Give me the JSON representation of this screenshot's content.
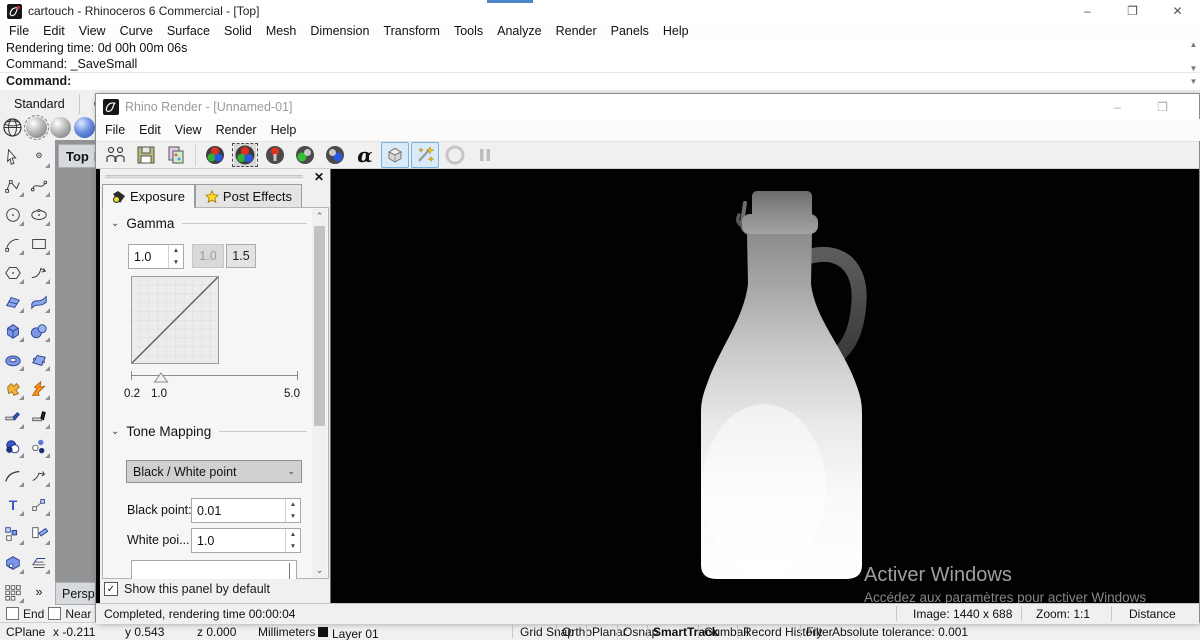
{
  "colors": {
    "accent_blue": "#4a86c8",
    "selection_bg": "#d9eaf8",
    "selection_border": "#7ab0de",
    "viewport_gray": "#919395",
    "watermark": "#9f9f9f",
    "render_bg": "#020202"
  },
  "icons": {
    "close": "✕",
    "minimize": "–",
    "restore": "❐",
    "chevron_down": "⌄",
    "dropdown": "˅",
    "scroll_up": "▲",
    "scroll_down": "▼",
    "spin_up": "▲",
    "spin_down": "▼",
    "check": "✓",
    "expand": "»",
    "viewport_dropdown": "▼",
    "alpha": "α"
  },
  "app": {
    "title": "cartouch - Rhinoceros 6 Commercial - [Top]",
    "menus": [
      "File",
      "Edit",
      "View",
      "Curve",
      "Surface",
      "Solid",
      "Mesh",
      "Dimension",
      "Transform",
      "Tools",
      "Analyze",
      "Render",
      "Panels",
      "Help"
    ],
    "cmd": {
      "line1": "Rendering time: 0d 00h 00m 06s",
      "line2": "Command: _SaveSmall",
      "prompt": "Command:"
    },
    "toolbar_tabs": {
      "standard": "Standard",
      "second": "Cl"
    },
    "viewport_tab": "Top",
    "viewport_bottom_tab": "Persp",
    "osnap": {
      "end": "End",
      "near": "Near"
    }
  },
  "rw": {
    "title": "Rhino Render - [Unnamed-01]",
    "menus": [
      "File",
      "Edit",
      "View",
      "Render",
      "Help"
    ],
    "status": {
      "completed": "Completed, rendering time 00:00:04",
      "image": "Image: 1440 x 688",
      "zoom": "Zoom: 1:1",
      "distance": "Distance"
    }
  },
  "panel": {
    "tab_exposure": "Exposure",
    "tab_post_effects": "Post Effects",
    "gamma": {
      "title": "Gamma",
      "value": "1.0",
      "preset_disabled": "1.0",
      "preset_active": "1.5",
      "scale_labels": [
        "0.2",
        "1.0",
        "5.0"
      ]
    },
    "tone": {
      "title": "Tone Mapping",
      "dropdown": "Black / White point",
      "black_label": "Black point:",
      "black_value": "0.01",
      "white_label": "White poi...",
      "white_value": "1.0"
    },
    "show_default": "Show this panel by default"
  },
  "sb": {
    "cplane": "CPlane",
    "x": "x -0.211",
    "y": "y 0.543",
    "z": "z 0.000",
    "units": "Millimeters",
    "layer": "Layer 01",
    "toggles": [
      "Grid Snap",
      "Ortho",
      "Planar",
      "Osnap",
      "SmartTrack",
      "Gumball",
      "Record History",
      "Filter"
    ],
    "tolerance": "Absolute tolerance: 0.001"
  },
  "wm": {
    "line1": "Activer Windows",
    "line2": "Accédez aux paramètres pour activer Windows"
  }
}
